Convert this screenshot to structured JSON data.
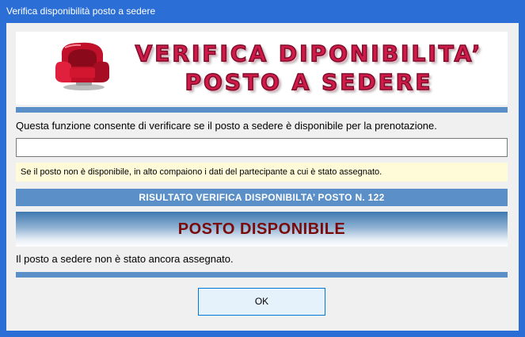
{
  "window": {
    "title": "Verifica disponibilità posto a sedere",
    "accent_color": "#2b6fd6"
  },
  "banner": {
    "icon": "armchair-icon",
    "line1": "VERIFICA DIPONIBILITA’",
    "line2": "POSTO A SEDERE",
    "text_color": "#d21a4a"
  },
  "description": "Questa funzione consente di verificare se il posto a sedere è disponibile per la prenotazione.",
  "input": {
    "value": "",
    "placeholder": ""
  },
  "note": "Se il posto non è disponibile, in alto compaiono i dati del partecipante a cui è stato assegnato.",
  "result": {
    "header": "RISULTATO VERIFICA DISPONIBILTA’ POSTO N.  122",
    "status_title": "POSTO DISPONIBILE",
    "status_message": "Il posto a sedere non è stato ancora assegnato.",
    "header_color": "#5b8fc7",
    "status_color": "#7a0a0a"
  },
  "buttons": {
    "ok_label": "OK"
  }
}
